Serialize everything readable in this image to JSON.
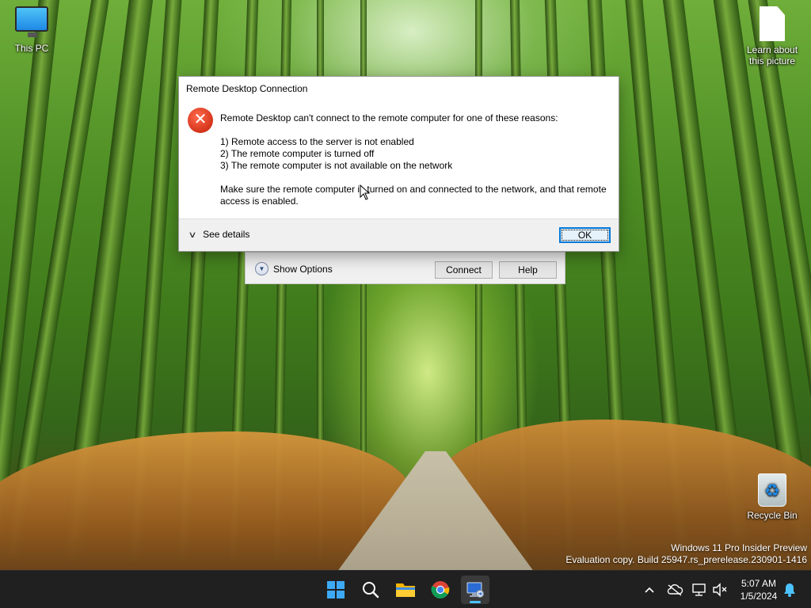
{
  "desktop": {
    "icons": {
      "this_pc": "This PC",
      "learn_line1": "Learn about",
      "learn_line2": "this picture",
      "recycle_bin": "Recycle Bin"
    },
    "watermark": {
      "line1": "Windows 11 Pro Insider Preview",
      "line2": "Evaluation copy. Build 25947.rs_prerelease.230901-1416"
    }
  },
  "rdc_window": {
    "show_options_label": "Show Options",
    "connect_label": "Connect",
    "help_label": "Help"
  },
  "error_dialog": {
    "title": "Remote Desktop Connection",
    "heading": "Remote Desktop can't connect to the remote computer for one of these reasons:",
    "reasons": [
      "1) Remote access to the server is not enabled",
      "2) The remote computer is turned off",
      "3) The remote computer is not available on the network"
    ],
    "advice": "Make sure the remote computer is turned on and connected to the network, and that remote access is enabled.",
    "see_details_label": "See details",
    "ok_label": "OK"
  },
  "taskbar": {
    "apps": [
      "start-icon",
      "search-icon",
      "file-explorer-icon",
      "chrome-icon",
      "remote-desktop-icon"
    ],
    "active_app": "remote-desktop-icon",
    "clock": {
      "time": "5:07 AM",
      "date": "1/5/2024"
    }
  },
  "colors": {
    "accent": "#0078d7",
    "error": "#d8381e",
    "taskbar": "#202020",
    "indicator": "#4cc2ff"
  }
}
